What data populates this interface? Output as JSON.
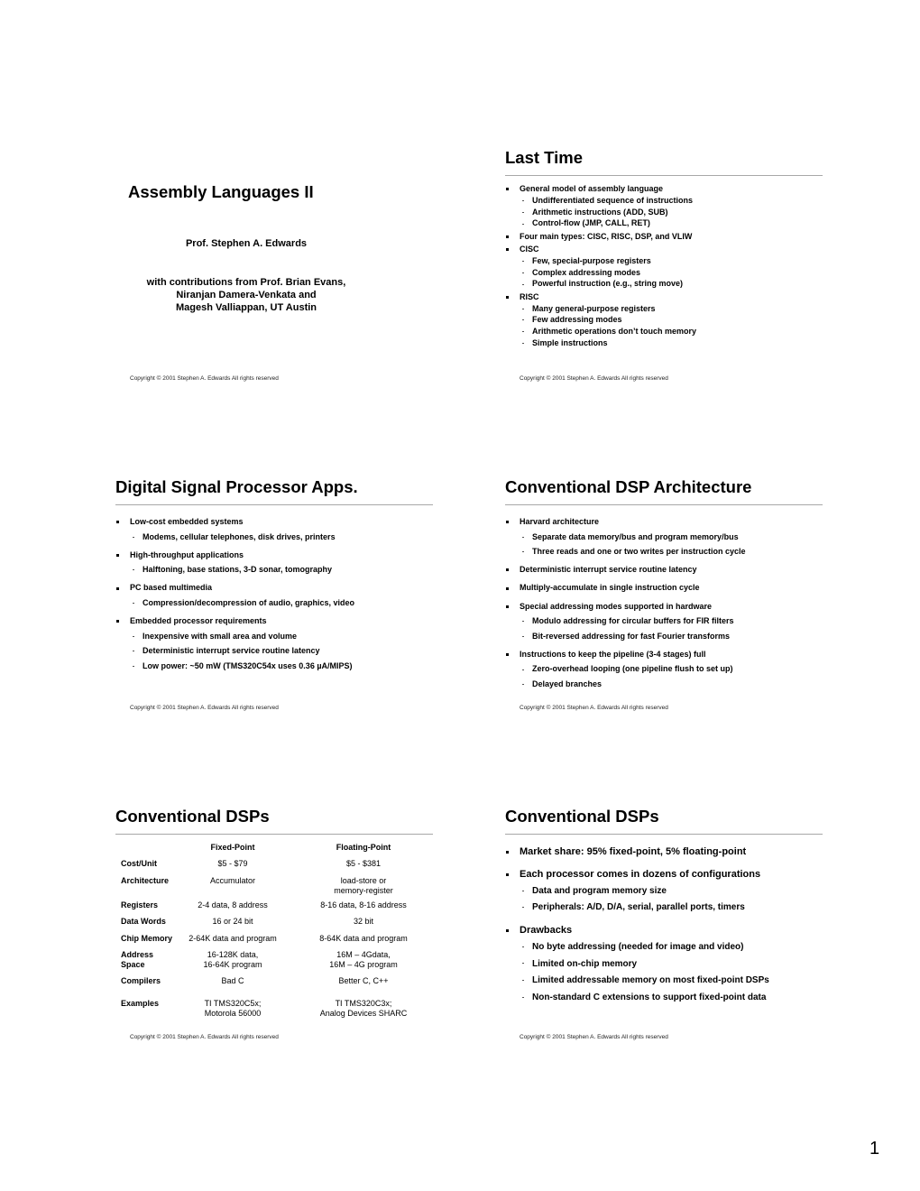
{
  "page_number": "1",
  "copyright": "Copyright © 2001 Stephen A. Edwards  All rights reserved",
  "slides": [
    {
      "title": "Assembly Languages II",
      "author": "Prof. Stephen A. Edwards",
      "contributors": [
        "with contributions from Prof. Brian Evans,",
        "Niranjan Damera-Venkata and",
        "Magesh Valliappan, UT Austin"
      ]
    },
    {
      "title": "Last Time",
      "bullets": [
        {
          "text": "General model of assembly language",
          "sub": [
            "Undifferentiated sequence of instructions",
            "Arithmetic instructions (ADD, SUB)",
            "Control-flow (JMP, CALL, RET)"
          ]
        },
        {
          "text": "Four main types: CISC, RISC, DSP, and VLIW",
          "sub": []
        },
        {
          "text": "CISC",
          "sub": [
            "Few, special-purpose registers",
            "Complex addressing modes",
            "Powerful instruction (e.g., string move)"
          ]
        },
        {
          "text": "RISC",
          "sub": [
            "Many general-purpose registers",
            "Few addressing modes",
            "Arithmetic operations don’t touch memory",
            "Simple instructions"
          ]
        }
      ]
    },
    {
      "title": "Digital Signal Processor Apps.",
      "bullets": [
        {
          "text": "Low-cost embedded systems",
          "sub": [
            "Modems, cellular telephones, disk drives, printers"
          ]
        },
        {
          "text": "High-throughput applications",
          "sub": [
            "Halftoning, base stations, 3-D sonar, tomography"
          ]
        },
        {
          "text": "PC based multimedia",
          "sub": [
            "Compression/decompression of audio, graphics, video"
          ]
        },
        {
          "text": "Embedded processor requirements",
          "sub": [
            "Inexpensive with small area and volume",
            "Deterministic interrupt service routine latency",
            "Low power: ~50 mW (TMS320C54x uses 0.36 µA/MIPS)"
          ]
        }
      ]
    },
    {
      "title": "Conventional DSP Architecture",
      "bullets": [
        {
          "text": "Harvard architecture",
          "sub": [
            "Separate data memory/bus and program memory/bus",
            "Three reads and one or two writes per instruction cycle"
          ]
        },
        {
          "text": "Deterministic interrupt service routine latency",
          "sub": []
        },
        {
          "text": "Multiply-accumulate in single instruction cycle",
          "sub": []
        },
        {
          "text": "Special addressing modes supported in hardware",
          "sub": [
            "Modulo addressing for circular buffers for FIR filters",
            "Bit-reversed addressing for fast Fourier transforms"
          ]
        },
        {
          "text": "Instructions to keep the pipeline (3-4 stages) full",
          "sub": [
            "Zero-overhead looping (one pipeline flush to set up)",
            "Delayed branches"
          ]
        }
      ]
    },
    {
      "title": "Conventional DSPs",
      "table": {
        "headers": [
          "",
          "Fixed-Point",
          "Floating-Point"
        ],
        "rows": [
          [
            "Cost/Unit",
            "$5 - $79",
            "$5 - $381"
          ],
          [
            "Architecture",
            "Accumulator",
            "load-store or\nmemory-register"
          ],
          [
            "Registers",
            "2-4 data, 8 address",
            "8-16 data, 8-16 address"
          ],
          [
            "Data Words",
            "16 or 24 bit",
            "32 bit"
          ],
          [
            "Chip Memory",
            "2-64K data and program",
            "8-64K data and program"
          ],
          [
            "Address\nSpace",
            "16-128K data,\n16-64K program",
            "16M – 4Gdata,\n16M – 4G program"
          ],
          [
            "Compilers",
            "Bad C",
            "Better C, C++"
          ],
          [
            "Examples",
            "TI TMS320C5x;\nMotorola 56000",
            "TI TMS320C3x;\nAnalog Devices SHARC"
          ]
        ]
      }
    },
    {
      "title": "Conventional DSPs",
      "bullets": [
        {
          "text": "Market share: 95% fixed-point, 5% floating-point",
          "sub": []
        },
        {
          "text": "Each processor comes in dozens of configurations",
          "sub": [
            "Data and program memory size",
            "Peripherals: A/D, D/A, serial, parallel ports, timers"
          ]
        },
        {
          "text": "Drawbacks",
          "sub": [
            "No byte addressing (needed for image and video)",
            "Limited on-chip memory",
            "Limited addressable memory on most fixed-point DSPs",
            "Non-standard C extensions to support fixed-point data"
          ]
        }
      ]
    }
  ]
}
